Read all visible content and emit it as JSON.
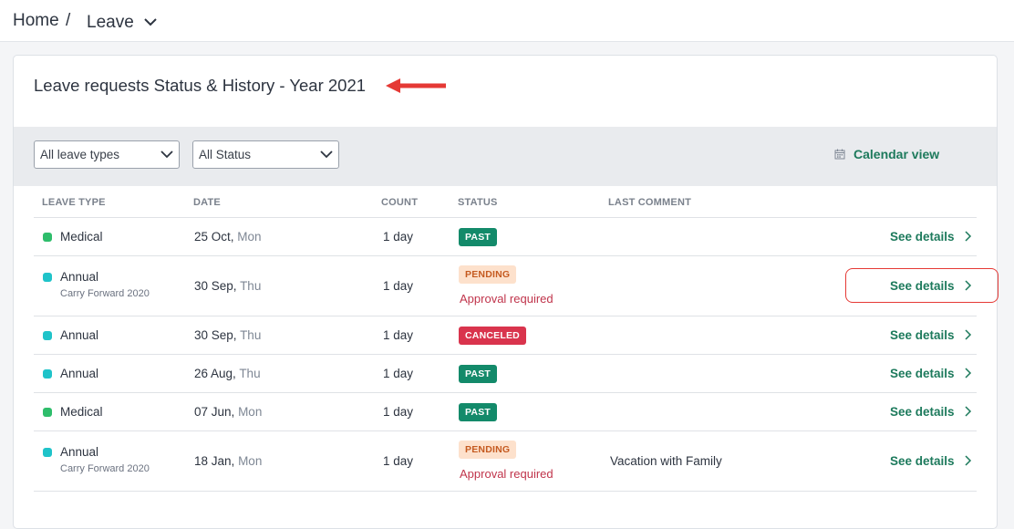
{
  "breadcrumb": {
    "home": "Home",
    "separator": "/",
    "current": "Leave"
  },
  "card": {
    "title": "Leave requests Status & History - Year 2021"
  },
  "filters": {
    "leave_type": "All leave types",
    "status": "All Status",
    "calendar_view": "Calendar view"
  },
  "table": {
    "headers": [
      "LEAVE TYPE",
      "DATE",
      "COUNT",
      "STATUS",
      "LAST COMMENT"
    ],
    "rows": [
      {
        "type": "Medical",
        "sub": "",
        "date": "25 Oct,",
        "dow": "Mon",
        "count": "1 day",
        "status": "PAST",
        "note": "",
        "comment": "",
        "action": "See details",
        "color": "#2ebd6b"
      },
      {
        "type": "Annual",
        "sub": "Carry Forward 2020",
        "date": "30 Sep,",
        "dow": "Thu",
        "count": "1 day",
        "status": "PENDING",
        "note": "Approval required",
        "comment": "",
        "action": "See details",
        "color": "#1fc3c9"
      },
      {
        "type": "Annual",
        "sub": "",
        "date": "30 Sep,",
        "dow": "Thu",
        "count": "1 day",
        "status": "CANCELED",
        "note": "",
        "comment": "",
        "action": "See details",
        "color": "#1fc3c9"
      },
      {
        "type": "Annual",
        "sub": "",
        "date": "26 Aug,",
        "dow": "Thu",
        "count": "1 day",
        "status": "PAST",
        "note": "",
        "comment": "",
        "action": "See details",
        "color": "#1fc3c9"
      },
      {
        "type": "Medical",
        "sub": "",
        "date": "07 Jun,",
        "dow": "Mon",
        "count": "1 day",
        "status": "PAST",
        "note": "",
        "comment": "",
        "action": "See details",
        "color": "#2ebd6b"
      },
      {
        "type": "Annual",
        "sub": "Carry Forward 2020",
        "date": "18 Jan,",
        "dow": "Mon",
        "count": "1 day",
        "status": "PENDING",
        "note": "Approval required",
        "comment": "Vacation with Family",
        "action": "See details",
        "color": "#1fc3c9"
      }
    ]
  },
  "colors": {
    "accent": "#1d7a5c",
    "past": "#138a6a",
    "pending_bg": "#fde1cc",
    "pending_text": "#c55a20",
    "canceled": "#d9344d",
    "annotation": "#e53935"
  },
  "icons": {
    "breadcrumb_dropdown": "chevron-down-icon",
    "calendar": "calendar-icon",
    "row_action": "chevron-right-icon",
    "annotation": "arrow-left-icon"
  }
}
